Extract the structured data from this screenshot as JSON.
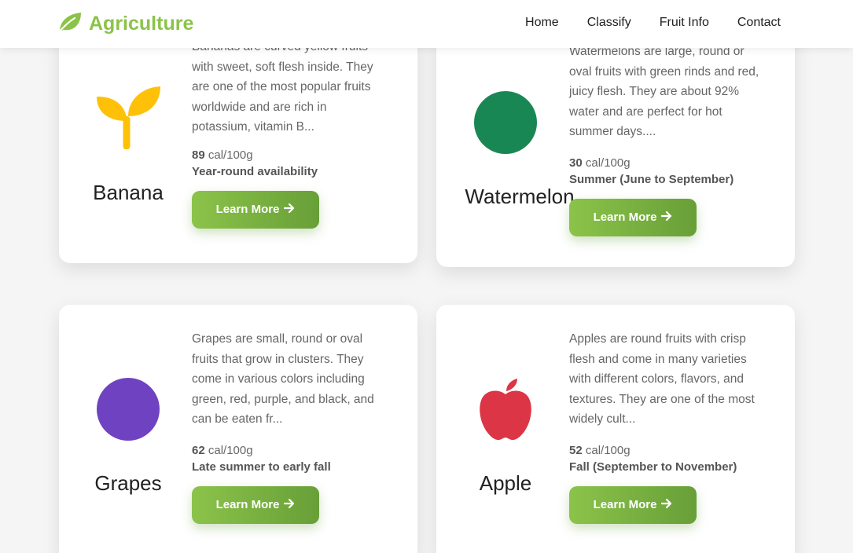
{
  "brand": {
    "name": "Agriculture",
    "icon": "leaf-icon",
    "color": "#8bc34a"
  },
  "nav": {
    "items": [
      {
        "label": "Home"
      },
      {
        "label": "Classify"
      },
      {
        "label": "Fruit Info"
      },
      {
        "label": "Contact"
      }
    ]
  },
  "cards": [
    {
      "name": "Banana",
      "icon": "sprout-icon",
      "icon_color": "#ffc107",
      "description": "Bananas are curved yellow fruits with sweet, soft flesh inside. They are one of the most popular fruits worldwide and are rich in potassium, vitamin B...",
      "calories": "89",
      "cal_unit": "cal/100g",
      "season": "Year-round availability",
      "button": "Learn More"
    },
    {
      "name": "Watermelon",
      "icon": "circle-icon",
      "icon_color": "#198754",
      "description": "Watermelons are large, round or oval fruits with green rinds and red, juicy flesh. They are about 92% water and are perfect for hot summer days....",
      "calories": "30",
      "cal_unit": "cal/100g",
      "season": "Summer (June to September)",
      "button": "Learn More"
    },
    {
      "name": "Grapes",
      "icon": "circle-icon",
      "icon_color": "#6f42c1",
      "description": "Grapes are small, round or oval fruits that grow in clusters. They come in various colors including green, red, purple, and black, and can be eaten fr...",
      "calories": "62",
      "cal_unit": "cal/100g",
      "season": "Late summer to early fall",
      "button": "Learn More"
    },
    {
      "name": "Apple",
      "icon": "apple-icon",
      "icon_color": "#dc3545",
      "description": "Apples are round fruits with crisp flesh and come in many varieties with different colors, flavors, and textures. They are one of the most widely cult...",
      "calories": "52",
      "cal_unit": "cal/100g",
      "season": "Fall (September to November)",
      "button": "Learn More"
    }
  ]
}
